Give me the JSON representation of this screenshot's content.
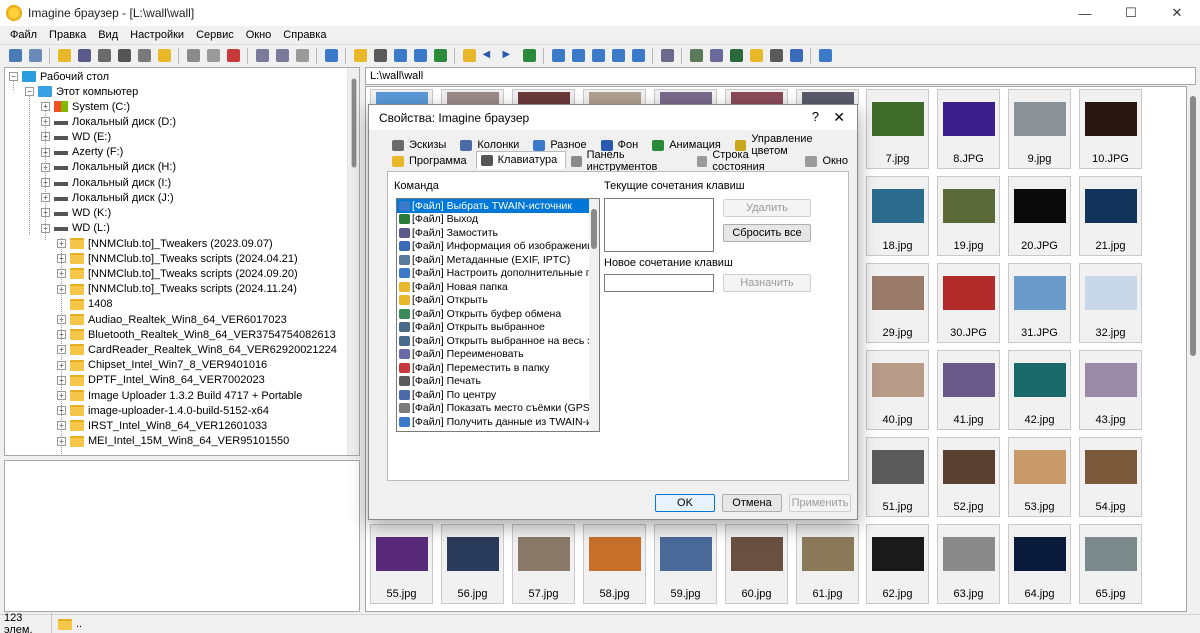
{
  "window": {
    "title": "Imagine браузер - [L:\\wall\\wall]",
    "minimize": "—",
    "maximize": "☐",
    "close": "✕"
  },
  "menu": [
    "Файл",
    "Правка",
    "Вид",
    "Настройки",
    "Сервис",
    "Окно",
    "Справка"
  ],
  "toolbar_icons": [
    "eye-icon",
    "browse-icon",
    "open-folder-icon",
    "save-icon",
    "print-icon",
    "info-icon",
    "properties-icon",
    "new-folder-icon",
    "copy-icon",
    "trash-icon",
    "cut-icon",
    "copy-icon",
    "paste-icon",
    "undo-icon",
    "view-icon",
    "thumbs-icon",
    "clock-icon",
    "grid-icon",
    "list-icon",
    "slideshow-icon",
    "up-folder-icon",
    "back-icon",
    "forward-icon",
    "refresh-icon",
    "view1-icon",
    "view2-icon",
    "view3-icon",
    "view4-icon",
    "view5-icon",
    "tools-icon",
    "batch-icon",
    "convert-icon",
    "filter-icon",
    "capture-icon",
    "scan-icon",
    "edit-icon",
    "help-icon"
  ],
  "tree": {
    "desktop": "Рабочий стол",
    "computer": "Этот компьютер",
    "drives": [
      "System (C:)",
      "Локальный диск (D:)",
      "WD (E:)",
      "Azerty (F:)",
      "Локальный диск (H:)",
      "Локальный диск (I:)",
      "Локальный диск (J:)",
      "WD (K:)",
      "WD (L:)"
    ],
    "folders": [
      "[NNMClub.to]_Tweakers (2023.09.07)",
      "[NNMClub.to]_Tweaks scripts (2024.04.21)",
      "[NNMClub.to]_Tweaks scripts (2024.09.20)",
      "[NNMClub.to]_Tweaks scripts (2024.11.24)",
      "1408",
      "Audiao_Realtek_Win8_64_VER6017023",
      "Bluetooth_Realtek_Win8_64_VER3754754082613",
      "CardReader_Realtek_Win8_64_VER62920021224",
      "Chipset_Intel_Win7_8_VER9401016",
      "DPTF_Intel_Win8_64_VER7002023",
      "Image Uploader 1.3.2 Build 4717 + Portable",
      "image-uploader-1.4.0-build-5152-x64",
      "IRST_Intel_Win8_64_VER12601033",
      "MEI_Intel_15M_Win8_64_VER95101550"
    ]
  },
  "address": "L:\\wall\\wall",
  "thumbnails": [
    {
      "name": "7.jpg",
      "color": "#3e6a2a"
    },
    {
      "name": "8.JPG",
      "color": "#3b1e8c"
    },
    {
      "name": "9.jpg",
      "color": "#8a9298"
    },
    {
      "name": "10.JPG",
      "color": "#2a1610"
    },
    {
      "name": "18.jpg",
      "color": "#2c6b8e"
    },
    {
      "name": "19.jpg",
      "color": "#5c6a3a"
    },
    {
      "name": "20.JPG",
      "color": "#0a0a0a"
    },
    {
      "name": "21.jpg",
      "color": "#12345a"
    },
    {
      "name": "29.jpg",
      "color": "#9a7a6a"
    },
    {
      "name": "30.JPG",
      "color": "#b22a2a"
    },
    {
      "name": "31.JPG",
      "color": "#6a9ac8"
    },
    {
      "name": "32.jpg",
      "color": "#c8d8e8"
    },
    {
      "name": "40.jpg",
      "color": "#b89a88"
    },
    {
      "name": "41.jpg",
      "color": "#6a5a8a"
    },
    {
      "name": "42.jpg",
      "color": "#1a6a6a"
    },
    {
      "name": "43.jpg",
      "color": "#9a8aa8"
    },
    {
      "name": "51.jpg",
      "color": "#5a5a5a"
    },
    {
      "name": "52.jpg",
      "color": "#5a4030"
    },
    {
      "name": "53.jpg",
      "color": "#c89a6a"
    },
    {
      "name": "54.jpg",
      "color": "#7a5a3a"
    },
    {
      "name": "55.jpg",
      "color": "#5a2a7a"
    },
    {
      "name": "56.jpg",
      "color": "#2a3a5a"
    },
    {
      "name": "57.jpg",
      "color": "#8a7a6a"
    },
    {
      "name": "58.jpg",
      "color": "#c8702a"
    },
    {
      "name": "59.jpg",
      "color": "#4a6a9a"
    },
    {
      "name": "60.jpg",
      "color": "#6a5040"
    },
    {
      "name": "61.jpg",
      "color": "#8a7a5a"
    },
    {
      "name": "62.jpg",
      "color": "#1a1a1a"
    },
    {
      "name": "63.jpg",
      "color": "#8a8a8a"
    },
    {
      "name": "64.jpg",
      "color": "#0a1a3a"
    },
    {
      "name": "65.jpg",
      "color": "#7a8a8a"
    }
  ],
  "top_partial_thumbs": [
    "#5a9ad8",
    "#9a8a8a",
    "#6a3a3a",
    "#b0a090",
    "#7a6a8a",
    "#8a4a5a",
    "#5a5a6a"
  ],
  "status": {
    "count": "123 элем.",
    "folder": ".."
  },
  "dialog": {
    "title": "Свойства: Imagine браузер",
    "help": "?",
    "close": "✕",
    "tabs_row1": [
      {
        "label": "Эскизы",
        "color": "#6a6a6a"
      },
      {
        "label": "Колонки",
        "color": "#4a6aa8"
      },
      {
        "label": "Разное",
        "color": "#3a7ac8"
      },
      {
        "label": "Фон",
        "color": "#2a5ab0"
      },
      {
        "label": "Анимация",
        "color": "#2a8a3a"
      },
      {
        "label": "Управление цветом",
        "color": "#c8a81a"
      }
    ],
    "tabs_row2": [
      {
        "label": "Программа",
        "color": "#e8b82a"
      },
      {
        "label": "Клавиатура",
        "color": "#555555"
      },
      {
        "label": "Панель инструментов",
        "color": "#8a8a8a"
      },
      {
        "label": "Строка состояния",
        "color": "#9a9a9a"
      },
      {
        "label": "Окно",
        "color": "#9a9a9a"
      }
    ],
    "command_label": "Команда",
    "commands": [
      {
        "label": "[Файл] Выбрать TWAIN-источник",
        "color": "#3a7ac8"
      },
      {
        "label": "[Файл] Выход",
        "color": "#2a7a3a"
      },
      {
        "label": "[Файл] Замостить",
        "color": "#5a5a8a"
      },
      {
        "label": "[Файл] Информация об изображении",
        "color": "#3a6ab8"
      },
      {
        "label": "[Файл] Метаданные (EXIF, IPTC)",
        "color": "#5a7a9a"
      },
      {
        "label": "[Файл] Настроить дополнительные про",
        "color": "#3a7ac8"
      },
      {
        "label": "[Файл] Новая папка",
        "color": "#e8b82a"
      },
      {
        "label": "[Файл] Открыть",
        "color": "#e8b82a"
      },
      {
        "label": "[Файл] Открыть буфер обмена",
        "color": "#3a8a5a"
      },
      {
        "label": "[Файл] Открыть выбранное",
        "color": "#4a6a8a"
      },
      {
        "label": "[Файл] Открыть выбранное на весь экр",
        "color": "#4a6a8a"
      },
      {
        "label": "[Файл] Переименовать",
        "color": "#6a6aa8"
      },
      {
        "label": "[Файл] Переместить в папку",
        "color": "#c83a3a"
      },
      {
        "label": "[Файл] Печать",
        "color": "#5a5a5a"
      },
      {
        "label": "[Файл] По центру",
        "color": "#4a6aa8"
      },
      {
        "label": "[Файл] Показать место съёмки (GPS)",
        "color": "#7a7a7a"
      },
      {
        "label": "[Файл] Получить данные из TWAIN-исто",
        "color": "#3a7ac8"
      }
    ],
    "current_keys_label": "Текущие сочетания клавиш",
    "new_keys_label": "Новое сочетание клавиш",
    "btn_delete": "Удалить",
    "btn_reset_all": "Сбросить все",
    "btn_assign": "Назначить",
    "btn_ok": "OK",
    "btn_cancel": "Отмена",
    "btn_apply": "Применить"
  }
}
